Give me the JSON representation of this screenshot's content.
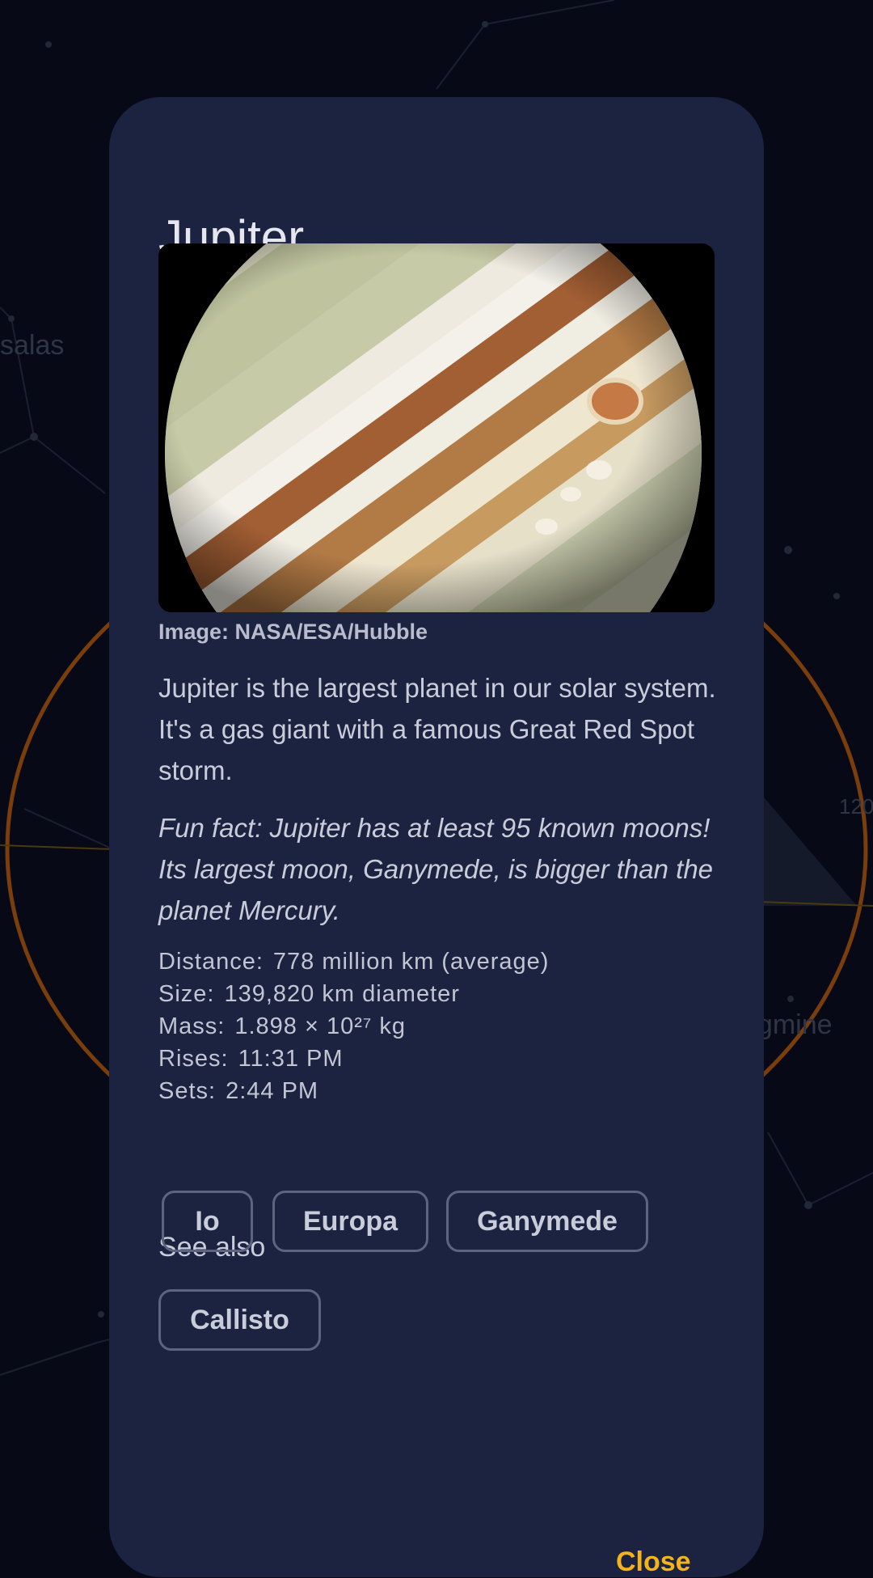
{
  "background": {
    "labels": [
      "salas",
      "egmine",
      "120"
    ],
    "ring_color": "#7a3d0c"
  },
  "dialog": {
    "title": "Jupiter",
    "image_credit": "Image: NASA/ESA/Hubble",
    "description": "Jupiter is the largest planet in our solar system. It's a gas giant with a famous Great Red Spot storm.",
    "fun_fact": "Fun fact: Jupiter has at least 95 known moons! Its largest moon, Ganymede, is bigger than the planet Mercury.",
    "stats": [
      {
        "label": "Distance:",
        "value": "778 million km (average)"
      },
      {
        "label": "Size:",
        "value": "139,820 km diameter"
      },
      {
        "label": "Mass:",
        "value": "1.898 × 10²⁷ kg"
      },
      {
        "label": "Rises:",
        "value": "11:31 PM"
      },
      {
        "label": "Sets:",
        "value": "2:44 PM"
      }
    ],
    "see_also_label": "See also",
    "see_also": [
      "Io",
      "Europa",
      "Ganymede",
      "Callisto"
    ],
    "close_label": "Close"
  },
  "colors": {
    "dialog_bg": "#1c2340",
    "accent": "#f3b319",
    "page_bg": "#070a16"
  }
}
